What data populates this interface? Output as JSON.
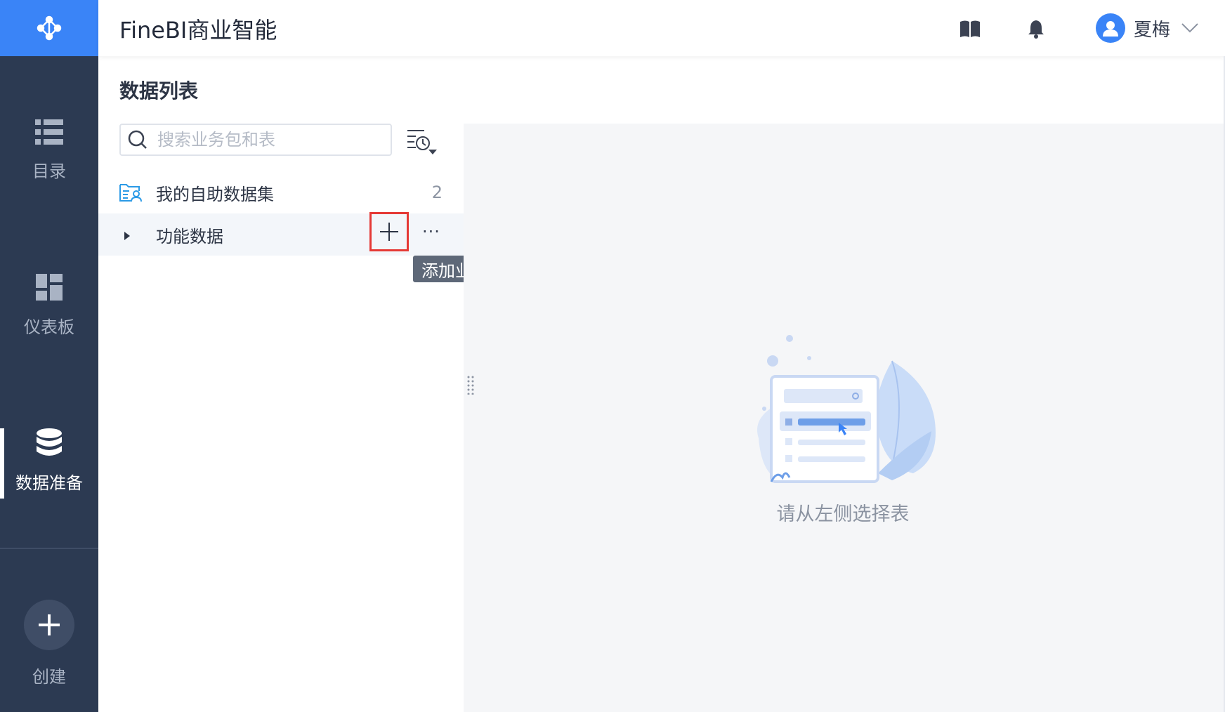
{
  "header": {
    "app_title": "FineBI商业智能",
    "user_name": "夏梅",
    "icons": [
      "book-icon",
      "bell-icon",
      "user-avatar-icon",
      "chevron-down-icon"
    ]
  },
  "sidebar": {
    "items": [
      {
        "label": "目录",
        "icon": "list-icon"
      },
      {
        "label": "仪表板",
        "icon": "dashboard-icon"
      },
      {
        "label": "数据准备",
        "icon": "database-icon",
        "active": true
      },
      {
        "label": "创建",
        "icon": "plus-icon"
      }
    ]
  },
  "panel": {
    "title": "数据列表",
    "search_placeholder": "搜索业务包和表",
    "my_dataset": {
      "label": "我的自助数据集",
      "count": "2"
    },
    "func_data": {
      "label": "功能数据"
    },
    "more_label": "···",
    "tooltip": "添加业务包"
  },
  "empty_state": {
    "text": "请从左侧选择表"
  },
  "colors": {
    "sidebar_bg": "#2c3a52",
    "accent": "#3a84f7",
    "highlight_border": "#e53935",
    "content_bg": "#f5f6f8"
  }
}
